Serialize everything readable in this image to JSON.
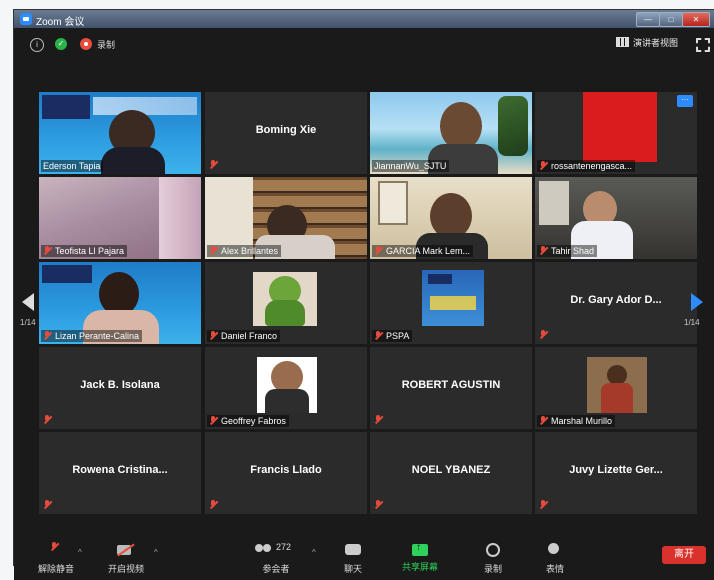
{
  "window": {
    "title": "Zoom 会议",
    "min": "—",
    "max": "□",
    "close": "✕"
  },
  "topbar": {
    "record_label": "录制",
    "view_label": "演讲者视图",
    "shield_glyph": "✓",
    "info_glyph": "i"
  },
  "pagination": {
    "left": "1/14",
    "right": "1/14"
  },
  "tiles": [
    {
      "name": "Ederson Tapia",
      "big": ""
    },
    {
      "name": "",
      "big": "Boming Xie"
    },
    {
      "name": "JiannanWu_SJTU",
      "big": ""
    },
    {
      "name": "rossantenengasca...",
      "big": ""
    },
    {
      "name": "Teofista Ll Pajara",
      "big": ""
    },
    {
      "name": "Alex Brillantes",
      "big": ""
    },
    {
      "name": "GARCIA Mark Lem...",
      "big": ""
    },
    {
      "name": "Tahir Shad",
      "big": ""
    },
    {
      "name": "Lizan Perante-Calina",
      "big": ""
    },
    {
      "name": "Daniel Franco",
      "big": ""
    },
    {
      "name": "PSPA",
      "big": ""
    },
    {
      "name": "",
      "big": "Dr. Gary Ador D..."
    },
    {
      "name": "",
      "big": "Jack B. Isolana"
    },
    {
      "name": "Geoffrey Fabros",
      "big": ""
    },
    {
      "name": "",
      "big": "ROBERT AGUSTIN"
    },
    {
      "name": "Marshal Murillo",
      "big": ""
    },
    {
      "name": "",
      "big": "Rowena Cristina..."
    },
    {
      "name": "",
      "big": "Francis Llado"
    },
    {
      "name": "",
      "big": "NOEL YBANEZ"
    },
    {
      "name": "",
      "big": "Juvy Lizette Ger..."
    }
  ],
  "toolbar": {
    "unmute": "解除静音",
    "start_video": "开启视频",
    "participants": "参会者",
    "participant_count": "272",
    "chat": "聊天",
    "share": "共享屏幕",
    "record": "录制",
    "reactions": "表情",
    "end": "离开"
  },
  "colors": {
    "accent": "#2d8cff",
    "share": "#2ed15a",
    "end": "#d9312b",
    "active_speaker": "#c4e05b"
  }
}
